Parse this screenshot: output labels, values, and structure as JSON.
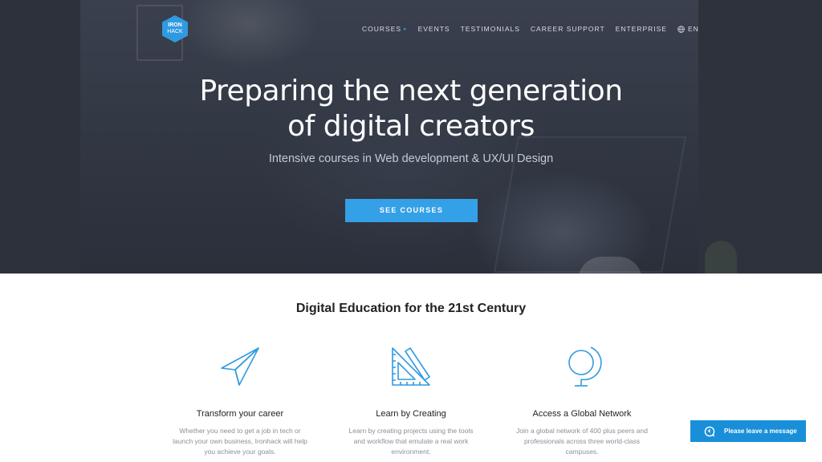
{
  "logo": {
    "line1": "IRON",
    "line2": "HACK"
  },
  "nav": {
    "items": [
      {
        "label": "COURSES",
        "has_caret": true
      },
      {
        "label": "EVENTS"
      },
      {
        "label": "TESTIMONIALS"
      },
      {
        "label": "CAREER SUPPORT"
      },
      {
        "label": "ENTERPRISE"
      }
    ],
    "language": "EN"
  },
  "hero": {
    "title_line1": "Preparing the next generation",
    "title_line2": "of digital creators",
    "subtitle": "Intensive courses in Web development & UX/UI Design",
    "cta_label": "SEE COURSES"
  },
  "section": {
    "title": "Digital Education for the 21st Century"
  },
  "features": [
    {
      "icon": "paper-plane-icon",
      "title": "Transform your career",
      "text": "Whether you need to get a job in tech or launch your own business, Ironhack will help you achieve your goals."
    },
    {
      "icon": "ruler-triangle-icon",
      "title": "Learn by Creating",
      "text": "Learn by creating projects using the tools and workflow that emulate a real work environment."
    },
    {
      "icon": "globe-icon",
      "title": "Access a Global Network",
      "text": "Join a global network of 400 plus peers and professionals across three world-class campuses."
    }
  ],
  "chat": {
    "label": "Please leave a message"
  },
  "colors": {
    "accent": "#34a0e8",
    "hero_bg": "#2a2f3a",
    "chat_bg": "#1a8fd9"
  }
}
